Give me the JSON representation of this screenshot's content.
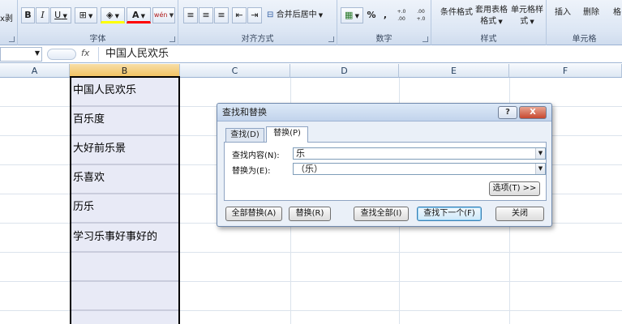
{
  "ribbon": {
    "clipboard_partial": "x剥",
    "font": {
      "group_label": "字体",
      "bold": "B",
      "italic": "I",
      "underline": "U",
      "font_color_glyph": "A",
      "phonetic_glyph": "wén"
    },
    "alignment": {
      "group_label": "对齐方式",
      "merge_label": "合并后居中"
    },
    "number": {
      "group_label": "数字",
      "percent": "%",
      "comma": ",",
      "inc_decimal": "+.0 .00",
      "dec_decimal": ".00 +.0"
    },
    "styles": {
      "group_label": "样式",
      "conditional": "条件格式",
      "table_format": "套用表格格式",
      "cell_styles": "单元格样式"
    },
    "cells": {
      "group_label": "单元格",
      "insert": "插入",
      "delete": "删除",
      "format_partial": "格"
    }
  },
  "formula_bar": {
    "fx": "fx",
    "value": "中国人民欢乐"
  },
  "columns": [
    "A",
    "B",
    "C",
    "D",
    "E",
    "F"
  ],
  "cells_b": [
    "中国人民欢乐",
    "百乐度",
    "大好前乐景",
    "乐喜欢",
    "历乐",
    "学习乐事好事好的"
  ],
  "dialog": {
    "title": "查找和替换",
    "help": "?",
    "close": "X",
    "tabs": {
      "find": "查找(D)",
      "replace": "替换(P)"
    },
    "find_label": "查找内容(N):",
    "find_value": "乐",
    "replace_label": "替换为(E):",
    "replace_value": "（乐）",
    "options_button": "选项(T) >>",
    "buttons": {
      "replace_all": "全部替换(A)",
      "replace": "替换(R)",
      "find_all": "查找全部(I)",
      "find_next": "查找下一个(F)",
      "close": "关闭"
    }
  }
}
